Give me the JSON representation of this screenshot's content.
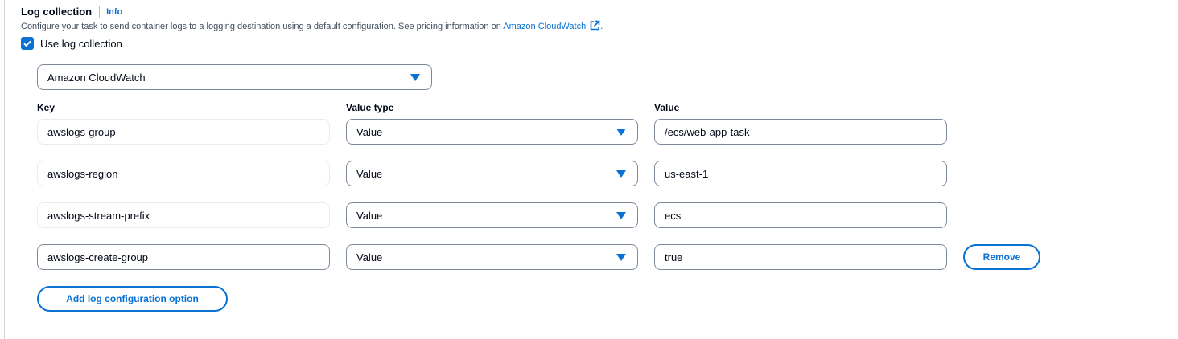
{
  "section": {
    "title": "Log collection",
    "info_label": "Info",
    "description_prefix": "Configure your task to send container logs to a logging destination using a default configuration. See pricing information on ",
    "description_link": "Amazon CloudWatch",
    "description_suffix": "."
  },
  "use_log_collection": {
    "label": "Use log collection",
    "checked": true
  },
  "destination": {
    "selected": "Amazon CloudWatch"
  },
  "columns": {
    "key": "Key",
    "value_type": "Value type",
    "value": "Value"
  },
  "options": [
    {
      "key": "awslogs-group",
      "value_type": "Value",
      "value": "/ecs/web-app-task"
    },
    {
      "key": "awslogs-region",
      "value_type": "Value",
      "value": "us-east-1"
    },
    {
      "key": "awslogs-stream-prefix",
      "value_type": "Value",
      "value": "ecs"
    },
    {
      "key": "awslogs-create-group",
      "value_type": "Value",
      "value": "true"
    }
  ],
  "remove_label": "Remove",
  "add_label": "Add log configuration option",
  "colors": {
    "accent": "#0972d3",
    "border": "#7d8998",
    "text": "#000716"
  }
}
